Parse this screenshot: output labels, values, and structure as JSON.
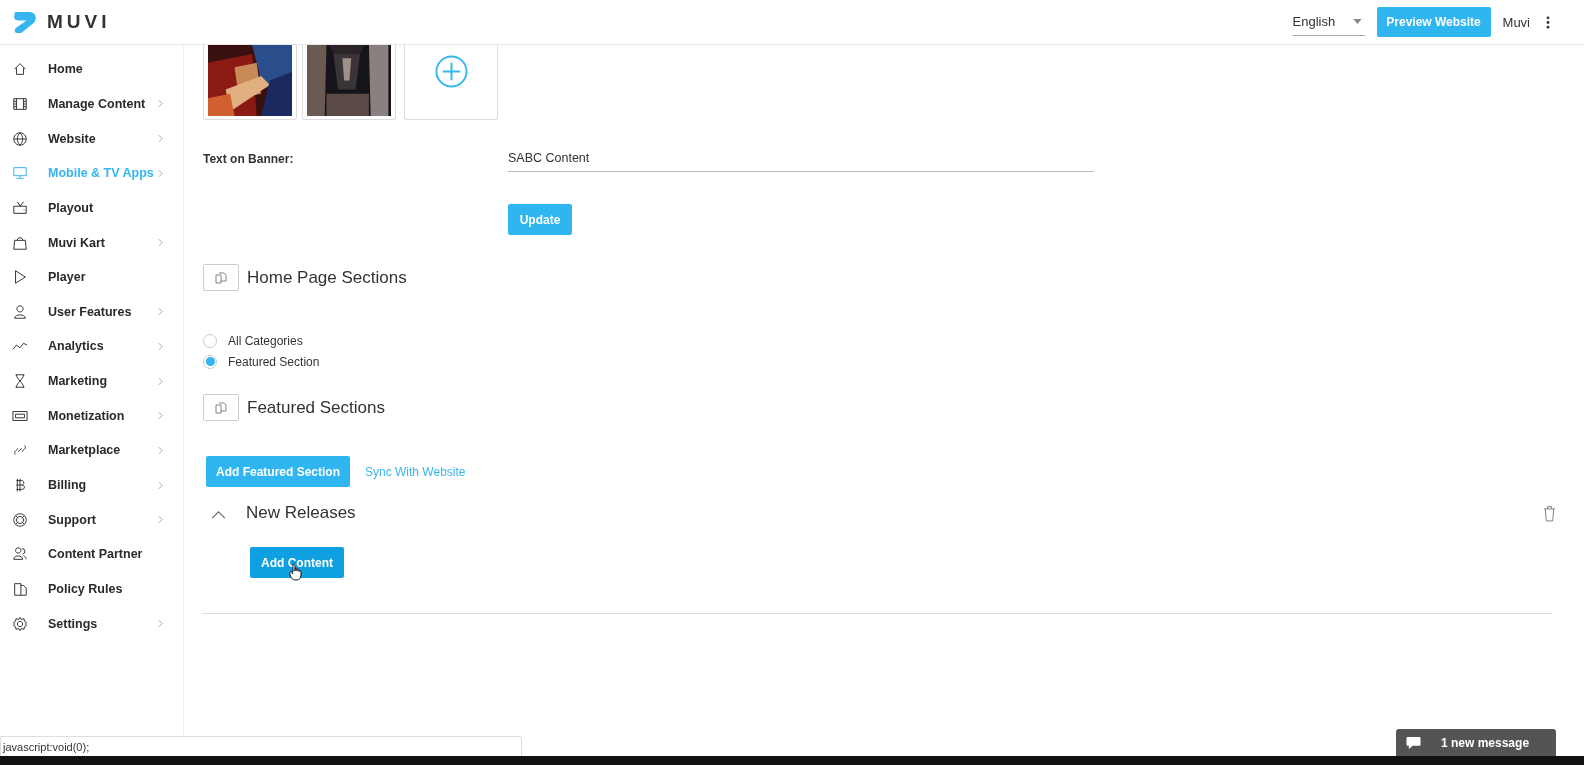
{
  "header": {
    "logo": "MUVI",
    "language": "English",
    "preview_button": "Preview Website",
    "user": "Muvi"
  },
  "sidebar": {
    "items": [
      {
        "label": "Home",
        "selected": false,
        "has_submenu": false
      },
      {
        "label": "Manage Content",
        "selected": false,
        "has_submenu": true
      },
      {
        "label": "Website",
        "selected": false,
        "has_submenu": true
      },
      {
        "label": "Mobile & TV Apps",
        "selected": true,
        "has_submenu": true
      },
      {
        "label": "Playout",
        "selected": false,
        "has_submenu": false
      },
      {
        "label": "Muvi Kart",
        "selected": false,
        "has_submenu": true
      },
      {
        "label": "Player",
        "selected": false,
        "has_submenu": false
      },
      {
        "label": "User Features",
        "selected": false,
        "has_submenu": true
      },
      {
        "label": "Analytics",
        "selected": false,
        "has_submenu": true
      },
      {
        "label": "Marketing",
        "selected": false,
        "has_submenu": true
      },
      {
        "label": "Monetization",
        "selected": false,
        "has_submenu": true
      },
      {
        "label": "Marketplace",
        "selected": false,
        "has_submenu": true
      },
      {
        "label": "Billing",
        "selected": false,
        "has_submenu": true
      },
      {
        "label": "Support",
        "selected": false,
        "has_submenu": true
      },
      {
        "label": "Content Partner",
        "selected": false,
        "has_submenu": false
      },
      {
        "label": "Policy Rules",
        "selected": false,
        "has_submenu": false
      },
      {
        "label": "Settings",
        "selected": false,
        "has_submenu": true
      }
    ]
  },
  "banners": [
    {
      "kind": "picture"
    },
    {
      "kind": "picture"
    },
    {
      "kind": "add"
    }
  ],
  "banner_text": {
    "label": "Text on Banner:",
    "value": "SABC Content"
  },
  "update_button": "Update",
  "home_page_sections": {
    "title": "Home Page Sections",
    "options": [
      {
        "label": "All Categories",
        "selected": false
      },
      {
        "label": "Featured Section",
        "selected": true
      }
    ]
  },
  "featured_sections": {
    "title": "Featured Sections",
    "add_button": "Add Featured Section",
    "sync_link": "Sync With Website",
    "sections": [
      {
        "title": "New Releases",
        "expanded": true,
        "add_button": "Add Content"
      }
    ]
  },
  "status_bar": "javascript:void(0);",
  "chat": {
    "label": "1 new message"
  }
}
